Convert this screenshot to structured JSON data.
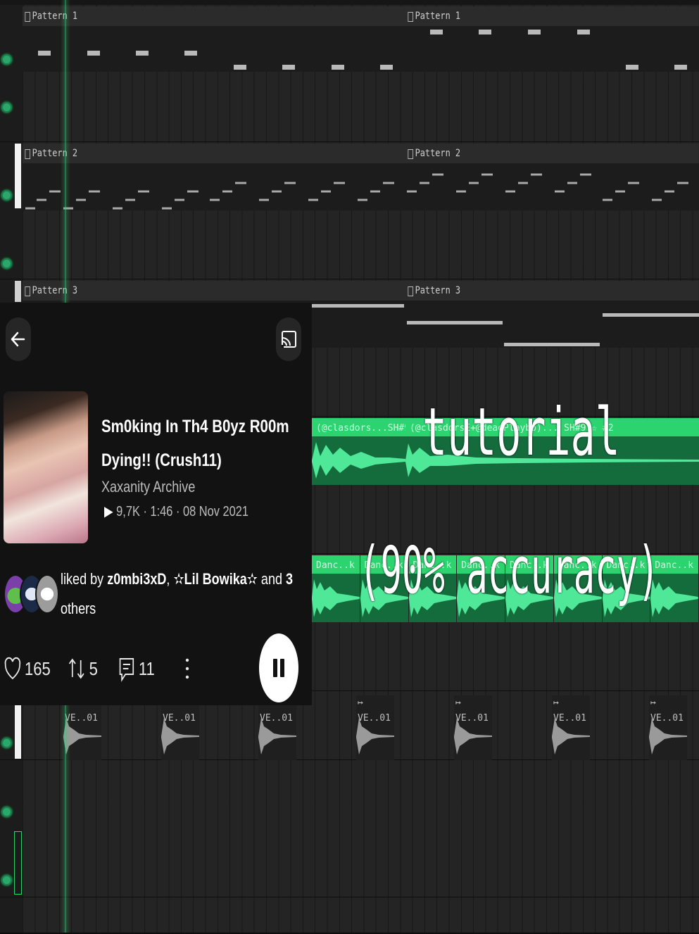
{
  "daw": {
    "pattern_1_label": "Pattern 1",
    "pattern_2_label": "Pattern 2",
    "pattern_3_label": "Pattern 3",
    "audio_clip_1_left": "(@clasdors...SH#9°☆ #2",
    "audio_clip_1_right": "(@clasdorsE+@deadPlaybo)... SH#9°☆ #2",
    "audio_clip_2_labels": [
      "Danc..k 1",
      "Danc..k 1",
      "Danc..k 1",
      "Danc..k 1",
      "Danc..k 1",
      "Danc..k 1",
      "Danc..k 1",
      "Danc..k 1"
    ],
    "ve_clip_label": "VE..01"
  },
  "overlay": {
    "line1": "tutorial",
    "line2": "(90% accuracy)"
  },
  "player": {
    "back_icon": "arrow-left-icon",
    "cast_icon": "cast-icon",
    "title_line1": "Sm0king In Th4 B0yz R00m",
    "title_line2": "Dying!! (Crush11)",
    "artist": "Xaxanity Archive",
    "stats": "9,7K · 1:46 · 08 Nov 2021",
    "liked_prefix": "liked by ",
    "liked_user1": "z0mbi3xD",
    "liked_sep": ", ",
    "liked_user2": "✫Lil Bowika✫",
    "liked_and": " and ",
    "liked_count": "3",
    "liked_suffix": "others",
    "likes": "165",
    "reposts": "5",
    "comments": "11",
    "colors": {
      "panel": "#121212",
      "accent": "#2bd46f"
    }
  }
}
